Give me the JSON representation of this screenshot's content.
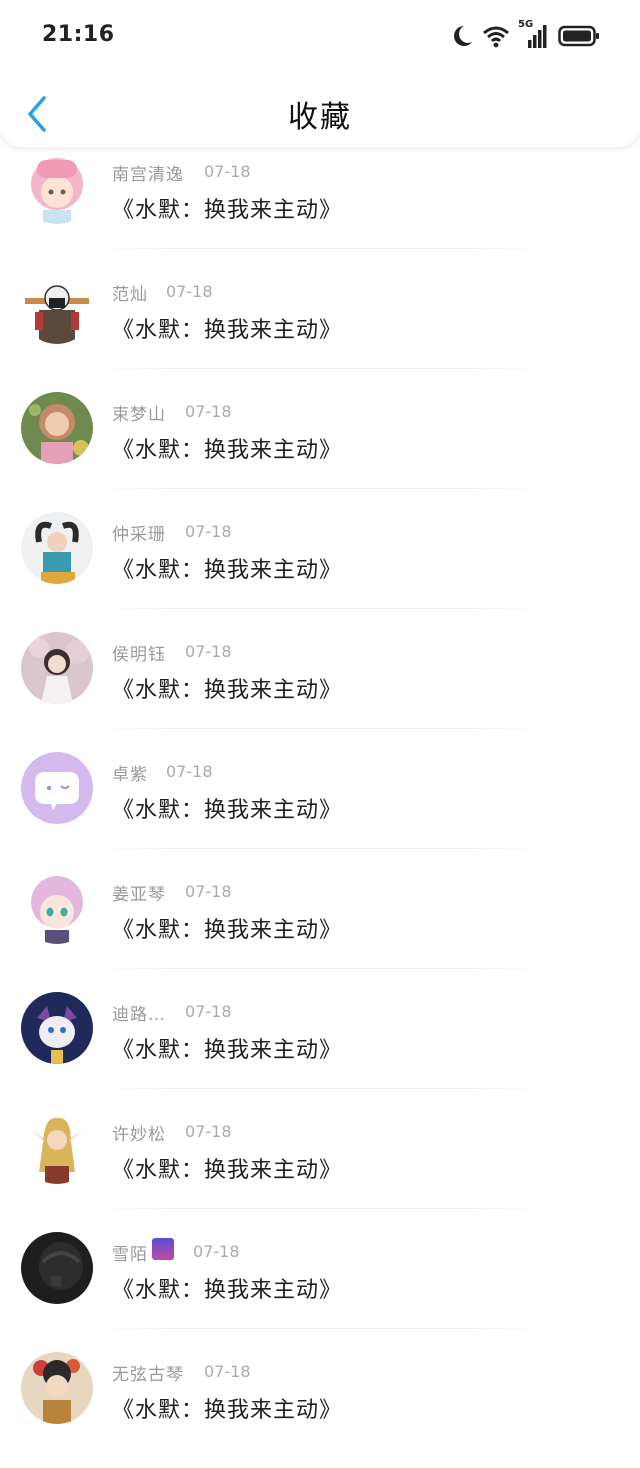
{
  "status_bar": {
    "time": "21:16",
    "network": "5G",
    "icons": [
      "moon-icon",
      "wifi-icon",
      "signal-icon",
      "battery-icon"
    ]
  },
  "header": {
    "title": "收藏",
    "back_icon": "chevron-left-icon",
    "accent_color": "#2a9fe8"
  },
  "favorites": [
    {
      "name": "南宫清逸",
      "date": "07-18",
      "message": "《水默：换我来主动》",
      "avatar": "anime-girl-pink"
    },
    {
      "name": "范灿",
      "date": "07-18",
      "message": "《水默：换我来主动》",
      "avatar": "cartoon-man"
    },
    {
      "name": "束梦山",
      "date": "07-18",
      "message": "《水默：换我来主动》",
      "avatar": "photo-girl"
    },
    {
      "name": "仲采珊",
      "date": "07-18",
      "message": "《水默：换我来主动》",
      "avatar": "photo-girl-heart"
    },
    {
      "name": "侯明钰",
      "date": "07-18",
      "message": "《水默：换我来主动》",
      "avatar": "photo-girl-sakura"
    },
    {
      "name": "卓紫",
      "date": "07-18",
      "message": "《水默：换我来主动》",
      "avatar": "default-chat"
    },
    {
      "name": "姜亚琴",
      "date": "07-18",
      "message": "《水默：换我来主动》",
      "avatar": "anime-girl-violet"
    },
    {
      "name": "迪路…",
      "date": "07-18",
      "message": "《水默：换我来主动》",
      "avatar": "digimon"
    },
    {
      "name": "许妙松",
      "date": "07-18",
      "message": "《水默：换我来主动》",
      "avatar": "elf-girl"
    },
    {
      "name": "雪陌",
      "date": "07-18",
      "message": "《水默：换我来主动》",
      "avatar": "dark-photo"
    },
    {
      "name": "无弦古琴",
      "date": "07-18",
      "message": "《水默：换我来主动》",
      "avatar": "ancient-girl"
    }
  ]
}
